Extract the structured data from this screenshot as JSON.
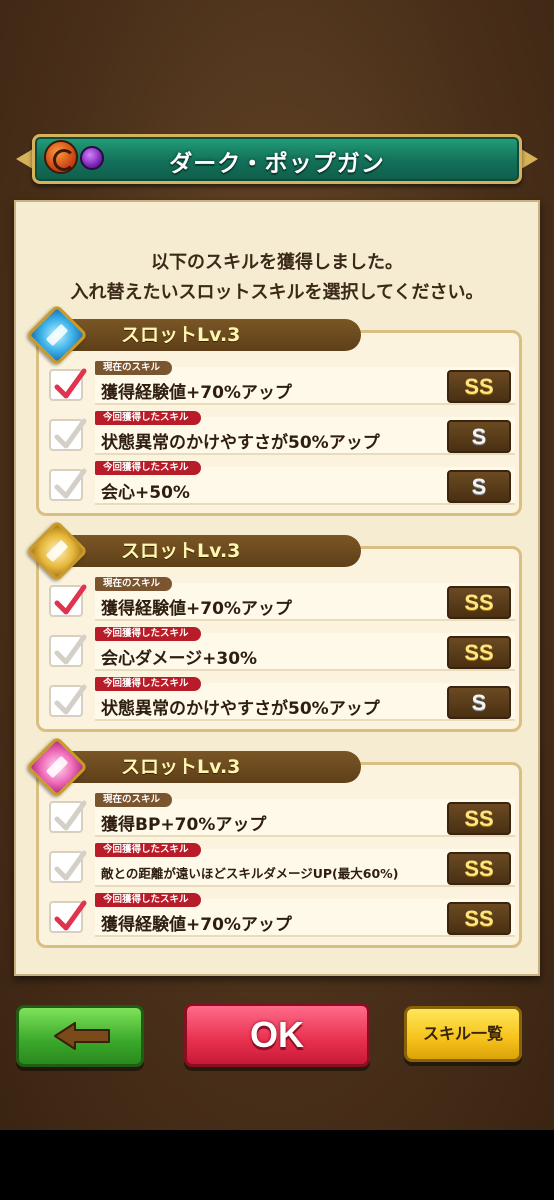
{
  "header": {
    "title": "ダーク・ポップガン",
    "attribute_icons": [
      "bow-attribute-icon",
      "dark-element-icon"
    ]
  },
  "message": {
    "line1": "以下のスキルを獲得しました。",
    "line2": "入れ替えたいスロットスキルを選択してください。"
  },
  "colors": {
    "banner_green": "#13705a",
    "parchment": "#f6ecd2",
    "check_red": "#e0344e",
    "ok_red": "#e8304e",
    "back_green": "#3aa82a",
    "skill_list_yellow": "#f5c21a"
  },
  "slots": [
    {
      "label": "スロットLv.3",
      "emblem": "blue-slot-emblem-icon",
      "skills": [
        {
          "tag": "現在のスキル",
          "name": "獲得経験値+70%アップ",
          "rank": "SS",
          "selected": true
        },
        {
          "tag": "今回獲得したスキル",
          "name": "状態異常のかけやすさが50%アップ",
          "rank": "S",
          "selected": false
        },
        {
          "tag": "今回獲得したスキル",
          "name": "会心+50%",
          "rank": "S",
          "selected": false
        }
      ]
    },
    {
      "label": "スロットLv.3",
      "emblem": "gold-slot-emblem-icon",
      "skills": [
        {
          "tag": "現在のスキル",
          "name": "獲得経験値+70%アップ",
          "rank": "SS",
          "selected": true
        },
        {
          "tag": "今回獲得したスキル",
          "name": "会心ダメージ+30%",
          "rank": "SS",
          "selected": false
        },
        {
          "tag": "今回獲得したスキル",
          "name": "状態異常のかけやすさが50%アップ",
          "rank": "S",
          "selected": false
        }
      ]
    },
    {
      "label": "スロットLv.3",
      "emblem": "pink-slot-emblem-icon",
      "skills": [
        {
          "tag": "現在のスキル",
          "name": "獲得BP+70%アップ",
          "rank": "SS",
          "selected": false
        },
        {
          "tag": "今回獲得したスキル",
          "name": "敵との距離が遠いほどスキルダメージUP(最大60%)",
          "rank": "SS",
          "selected": false
        },
        {
          "tag": "今回獲得したスキル",
          "name": "獲得経験値+70%アップ",
          "rank": "SS",
          "selected": true
        }
      ]
    }
  ],
  "buttons": {
    "back_icon": "left-arrow-icon",
    "ok_label": "OK",
    "skill_list_label": "スキル一覧"
  }
}
